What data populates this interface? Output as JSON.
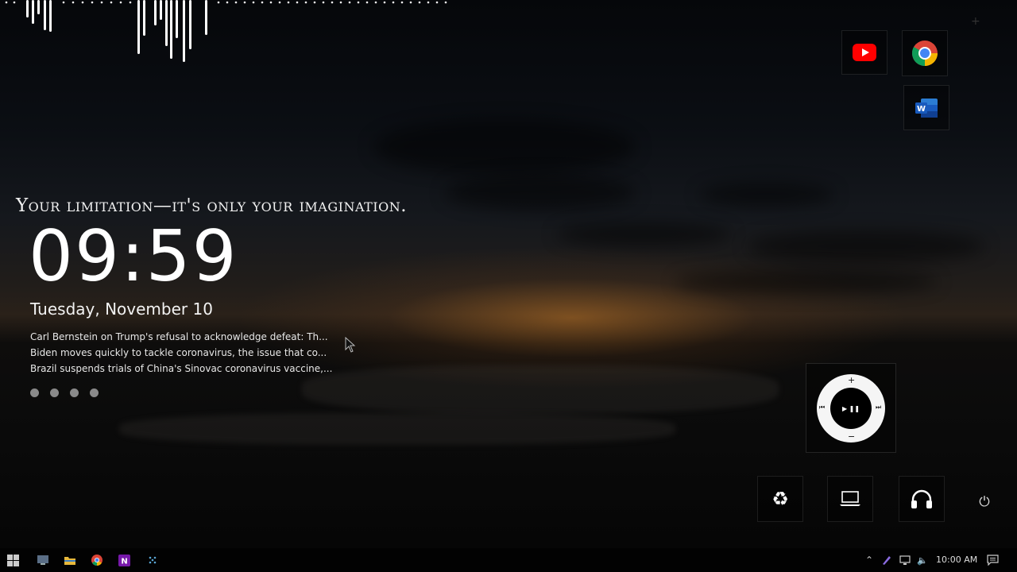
{
  "quote": "Your limitation—it's only your imagination.",
  "clock": {
    "time": "09:59",
    "date": "Tuesday, November 10"
  },
  "news": [
    "Carl Bernstein on Trump's refusal to acknowledge defeat: Th...",
    "Biden moves quickly to tackle coronavirus, the issue that co...",
    "Brazil suspends trials of China's Sinovac coronavirus vaccine,..."
  ],
  "news_pages": 4,
  "shortcuts": [
    {
      "name": "youtube-icon"
    },
    {
      "name": "chrome-icon"
    },
    {
      "name": "word-icon",
      "letter": "W"
    }
  ],
  "player": {
    "play_pause": "▶ ❚❚",
    "plus": "+",
    "minus": "−",
    "prev": "⏮",
    "next": "⏭"
  },
  "system_tiles": [
    {
      "name": "recycle-bin-icon",
      "glyph": "♻"
    },
    {
      "name": "computer-icon"
    },
    {
      "name": "headphones-icon"
    }
  ],
  "power_glyph": "⏻",
  "taskbar": {
    "time": "10:00 AM",
    "tray_chevron": "⌃",
    "volume": "🔈"
  },
  "colors": {
    "youtube": "#ff0000",
    "word": "#185abd",
    "onenote": "#7719aa"
  }
}
